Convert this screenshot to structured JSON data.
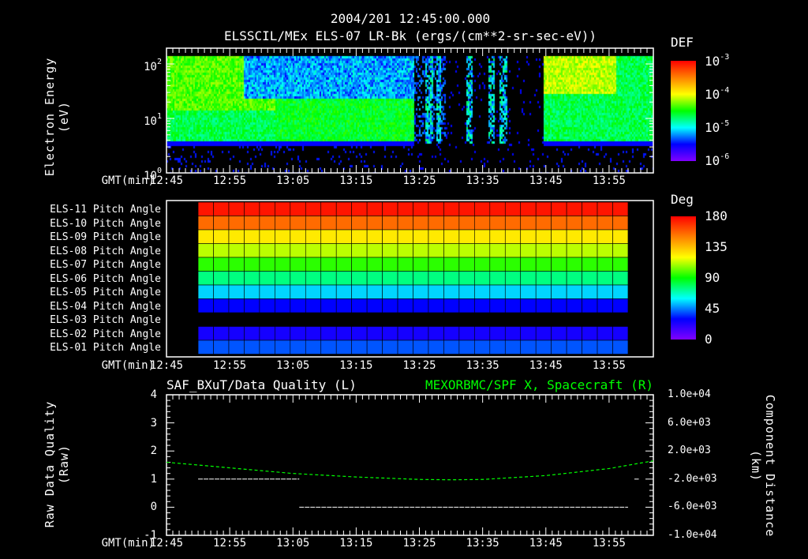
{
  "header": {
    "datetime": "2004/201 12:45:00.000",
    "panel1_title": "ELSSCIL/MEx ELS-07 LR-Bk  (ergs/(cm**2-sr-sec-eV))"
  },
  "time_axis": {
    "label": "GMT(min)",
    "ticks": [
      "12:45",
      "12:55",
      "13:05",
      "13:15",
      "13:25",
      "13:35",
      "13:45",
      "13:55"
    ]
  },
  "colors": {
    "background": "#000000",
    "axis": "#ffffff",
    "spacecraft_line": "#00ff00"
  },
  "chart_data": [
    {
      "type": "heatmap",
      "title": "ELSSCIL/MEx ELS-07 LR-Bk  (ergs/(cm**2-sr-sec-eV))",
      "ylabel": "Electron Energy",
      "yunits": "(eV)",
      "yscale": "log",
      "ylim": [
        1,
        150
      ],
      "y_ticks": [
        {
          "base": "10",
          "exp": "0"
        },
        {
          "base": "10",
          "exp": "1"
        },
        {
          "base": "10",
          "exp": "2"
        }
      ],
      "xlim": [
        "12:45",
        "14:02"
      ],
      "colorbar": {
        "label": "DEF",
        "scale": "log",
        "range": [
          1e-06,
          0.001
        ],
        "ticks": [
          {
            "base": "10",
            "exp": "-3"
          },
          {
            "base": "10",
            "exp": "-4"
          },
          {
            "base": "10",
            "exp": "-5"
          },
          {
            "base": "10",
            "exp": "-6"
          }
        ]
      },
      "regions": [
        {
          "from": "12:45",
          "to": "13:24",
          "low_energy_cutoff_eV": 4,
          "level": "green (~1e-4.5)"
        },
        {
          "from": "13:24",
          "to": "13:44",
          "level": "sparse / blue (~1e-6)"
        },
        {
          "from": "13:44",
          "to": "14:02",
          "low_energy_cutoff_eV": 4,
          "level": "green-yellow (~1e-4)"
        }
      ]
    },
    {
      "type": "heatmap",
      "rows": [
        {
          "label": "ELS-11 Pitch Angle",
          "value": 175
        },
        {
          "label": "ELS-10 Pitch Angle",
          "value": 155
        },
        {
          "label": "ELS-09 Pitch Angle",
          "value": 125
        },
        {
          "label": "ELS-08 Pitch Angle",
          "value": 112
        },
        {
          "label": "ELS-07 Pitch Angle",
          "value": 95
        },
        {
          "label": "ELS-06 Pitch Angle",
          "value": 75
        },
        {
          "label": "ELS-05 Pitch Angle",
          "value": 55
        },
        {
          "label": "ELS-04 Pitch Angle",
          "value": 30
        },
        {
          "label": "ELS-03 Pitch Angle",
          "value": null
        },
        {
          "label": "ELS-02 Pitch Angle",
          "value": 25
        },
        {
          "label": "ELS-01 Pitch Angle",
          "value": 40
        }
      ],
      "data_span": [
        "12:50",
        "13:58"
      ],
      "colorbar": {
        "label": "Deg",
        "range": [
          0,
          180
        ],
        "ticks": [
          "180",
          "135",
          "90",
          "45",
          "0"
        ]
      }
    },
    {
      "type": "line",
      "left_title": "SAF_BXuT/Data Quality (L)",
      "right_title": "MEXORBMC/SPF X, Spacecraft (R)",
      "ylabel_left": "Raw Data Quality",
      "yunits_left": "(Raw)",
      "ylabel_right": "Component Distance",
      "yunits_right": "(km)",
      "ylim_left": [
        -1,
        4
      ],
      "ylim_right": [
        -10000,
        10000
      ],
      "y_ticks_left": [
        "4",
        "3",
        "2",
        "1",
        "0",
        "-1"
      ],
      "y_ticks_right": [
        "1.0e+04",
        "6.0e+03",
        "2.0e+03",
        "-2.0e+03",
        "-6.0e+03",
        "-1.0e+04"
      ],
      "series": [
        {
          "name": "Data Quality",
          "axis": "left",
          "color": "#ffffff",
          "segments": [
            {
              "x": [
                "12:50",
                "13:06"
              ],
              "y": 1
            },
            {
              "x": [
                "13:06",
                "13:58"
              ],
              "y": 0
            },
            {
              "x": [
                "13:59",
                "13:59.7"
              ],
              "y": 1
            }
          ]
        },
        {
          "name": "Spacecraft X",
          "axis": "right",
          "color": "#00ff00",
          "x_min": [
            0,
            10,
            20,
            30,
            40,
            45,
            50,
            60,
            70,
            77
          ],
          "y": [
            400,
            -400,
            -1200,
            -1700,
            -2050,
            -2100,
            -2050,
            -1500,
            -500,
            600
          ]
        }
      ]
    }
  ]
}
